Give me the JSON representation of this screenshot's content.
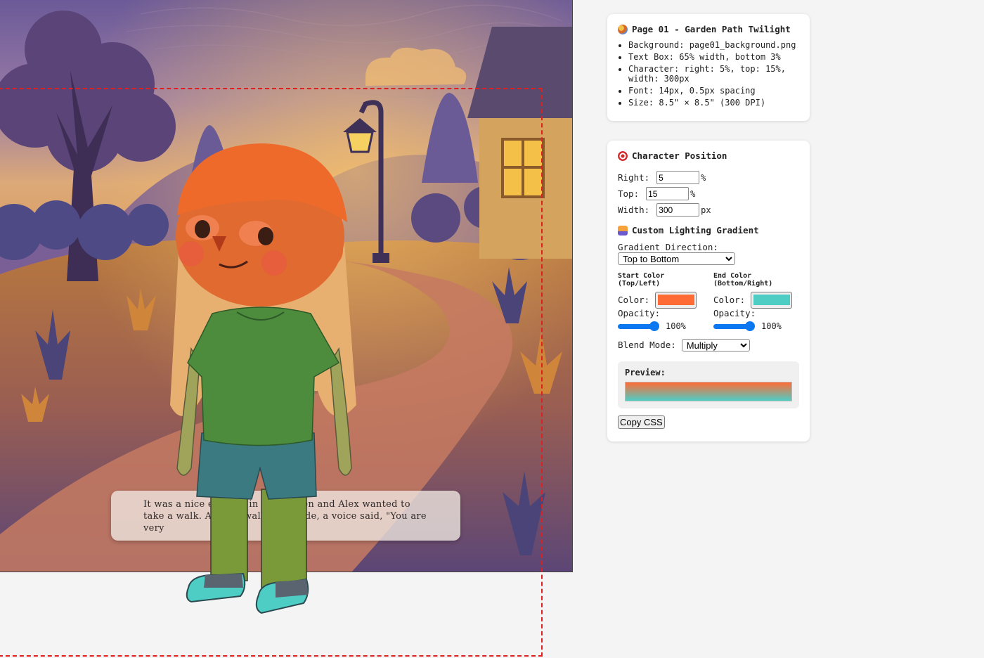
{
  "page": {
    "story_text": "It was a nice evening in the garden and Alex wanted to take a walk. As they walked outside, a voice said, \"You are very"
  },
  "info_panel": {
    "icon": "palette-icon",
    "title": "Page 01 - Garden Path Twilight",
    "items": [
      "Background: page01_background.png",
      "Text Box: 65% width, bottom 3%",
      "Character: right: 5%, top: 15%, width: 300px",
      "Font: 14px, 0.5px spacing",
      "Size: 8.5\" × 8.5\" (300 DPI)"
    ]
  },
  "position": {
    "icon": "target-icon",
    "title": "Character Position",
    "right_label": "Right:",
    "right_value": "5",
    "right_unit": "%",
    "top_label": "Top:",
    "top_value": "15",
    "top_unit": "%",
    "width_label": "Width:",
    "width_value": "300",
    "width_unit": "px"
  },
  "lighting": {
    "icon": "sunset-icon",
    "title": "Custom Lighting Gradient",
    "direction_label": "Gradient Direction:",
    "direction_value": "Top to Bottom",
    "start_title": "Start Color (Top/Left)",
    "end_title": "End Color (Bottom/Right)",
    "color_label": "Color:",
    "opacity_label": "Opacity:",
    "start_color": "#ff6b35",
    "end_color": "#4ecdc4",
    "start_opacity": "100%",
    "end_opacity": "100%",
    "start_opacity_value": 1.0,
    "end_opacity_value": 1.0,
    "blend_label": "Blend Mode:",
    "blend_value": "Multiply",
    "preview_label": "Preview:",
    "copy_button": "Copy CSS"
  }
}
